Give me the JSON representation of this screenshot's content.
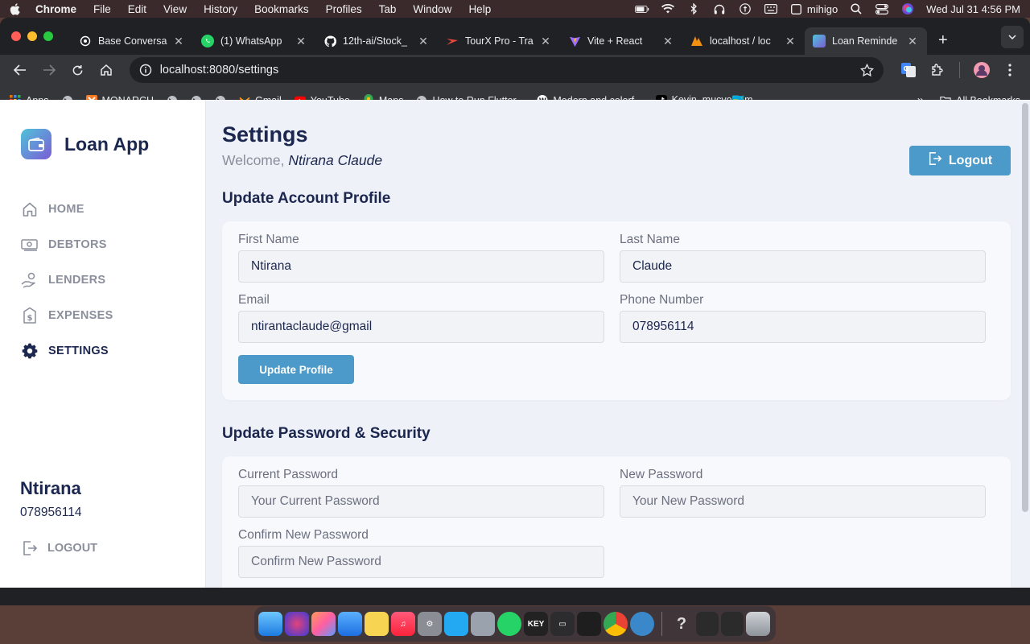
{
  "menubar": {
    "app": "Chrome",
    "items": [
      "File",
      "Edit",
      "View",
      "History",
      "Bookmarks",
      "Profiles",
      "Tab",
      "Window",
      "Help"
    ],
    "user": "mihigo",
    "datetime": "Wed Jul 31  4:56 PM"
  },
  "tabs": [
    {
      "title": "Base Conversa",
      "icon": "openai-icon",
      "color": "#ffffff"
    },
    {
      "title": "(1) WhatsApp",
      "icon": "whatsapp-icon",
      "color": "#25d366"
    },
    {
      "title": "12th-ai/Stock_",
      "icon": "github-icon",
      "color": "#ffffff"
    },
    {
      "title": "TourX Pro - Tra",
      "icon": "tourx-icon",
      "color": "#e8463b"
    },
    {
      "title": "Vite + React",
      "icon": "vite-icon",
      "color": "#9d6cff"
    },
    {
      "title": "localhost / loc",
      "icon": "phpmyadmin-icon",
      "color": "#f29111"
    },
    {
      "title": "Loan Reminde",
      "icon": "loan-app-icon",
      "color": "#4fc3d9"
    }
  ],
  "browser": {
    "url": "localhost:8080/settings"
  },
  "bookmarks": {
    "items": [
      "Apps",
      "MONARCH",
      "Gmail",
      "YouTube",
      "Maps",
      "How to Run Flutter...",
      "Modern and colorf...",
      "Kevin_mucyo🇷🇼m..."
    ],
    "all_label": "All Bookmarks"
  },
  "sidebar": {
    "brand": "Loan App",
    "nav": [
      {
        "label": "HOME",
        "icon": "home-icon"
      },
      {
        "label": "DEBTORS",
        "icon": "money-icon"
      },
      {
        "label": "LENDERS",
        "icon": "hand-money-icon"
      },
      {
        "label": "EXPENSES",
        "icon": "dollar-icon"
      },
      {
        "label": "SETTINGS",
        "icon": "gear-icon"
      }
    ],
    "active": "SETTINGS",
    "user_name": "Ntirana",
    "user_phone": "078956114",
    "logout": "LOGOUT"
  },
  "header": {
    "title": "Settings",
    "welcome_prefix": "Welcome,",
    "welcome_name": "Ntirana Claude",
    "logout": "Logout"
  },
  "profile": {
    "section_title": "Update Account Profile",
    "first_name_label": "First Name",
    "first_name_value": "Ntirana",
    "last_name_label": "Last Name",
    "last_name_value": "Claude",
    "email_label": "Email",
    "email_value": "ntirantaclaude@gmail",
    "phone_label": "Phone Number",
    "phone_value": "078956114",
    "submit": "Update Profile"
  },
  "security": {
    "section_title": "Update Password & Security",
    "current_label": "Current Password",
    "current_placeholder": "Your Current Password",
    "new_label": "New Password",
    "new_placeholder": "Your New Password",
    "confirm_label": "Confirm New Password",
    "confirm_placeholder": "Confirm New Password"
  },
  "colors": {
    "accent": "#4b9ac9",
    "navy": "#1c2750",
    "muted": "#8b8f9c",
    "page_bg": "#eef1f8"
  }
}
